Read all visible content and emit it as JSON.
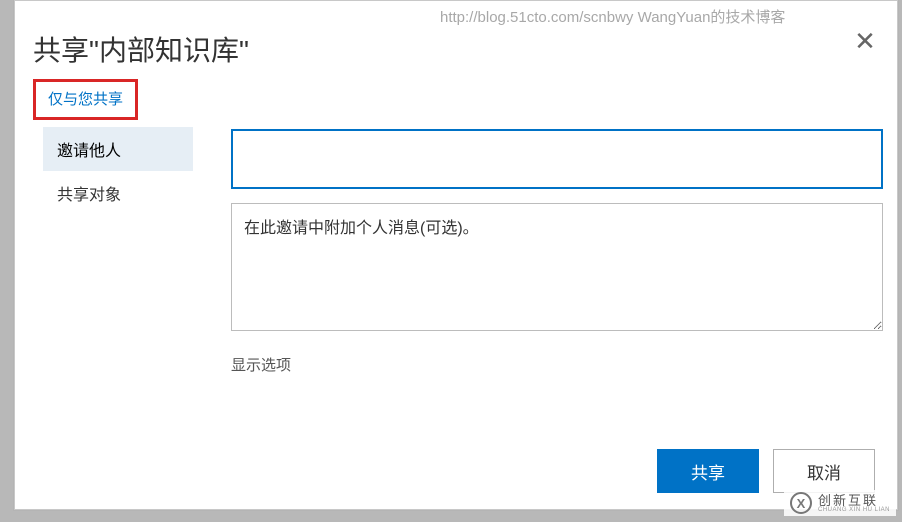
{
  "blog_url": "http://blog.51cto.com/scnbwy WangYuan的技术博客",
  "dialog": {
    "title": "共享\"内部知识库\"",
    "share_status_label": "仅与您共享",
    "close_icon": "✕"
  },
  "sidebar": {
    "items": [
      {
        "label": "邀请他人",
        "selected": true
      },
      {
        "label": "共享对象",
        "selected": false
      }
    ]
  },
  "main": {
    "recipients_value": "",
    "message_value": "",
    "message_placeholder": "在此邀请中附加个人消息(可选)。",
    "show_options_label": "显示选项"
  },
  "buttons": {
    "share_label": "共享",
    "cancel_label": "取消"
  },
  "watermark": {
    "logo_letter": "X",
    "cn": "创新互联",
    "en": "CHUANG XIN HU LIAN"
  }
}
